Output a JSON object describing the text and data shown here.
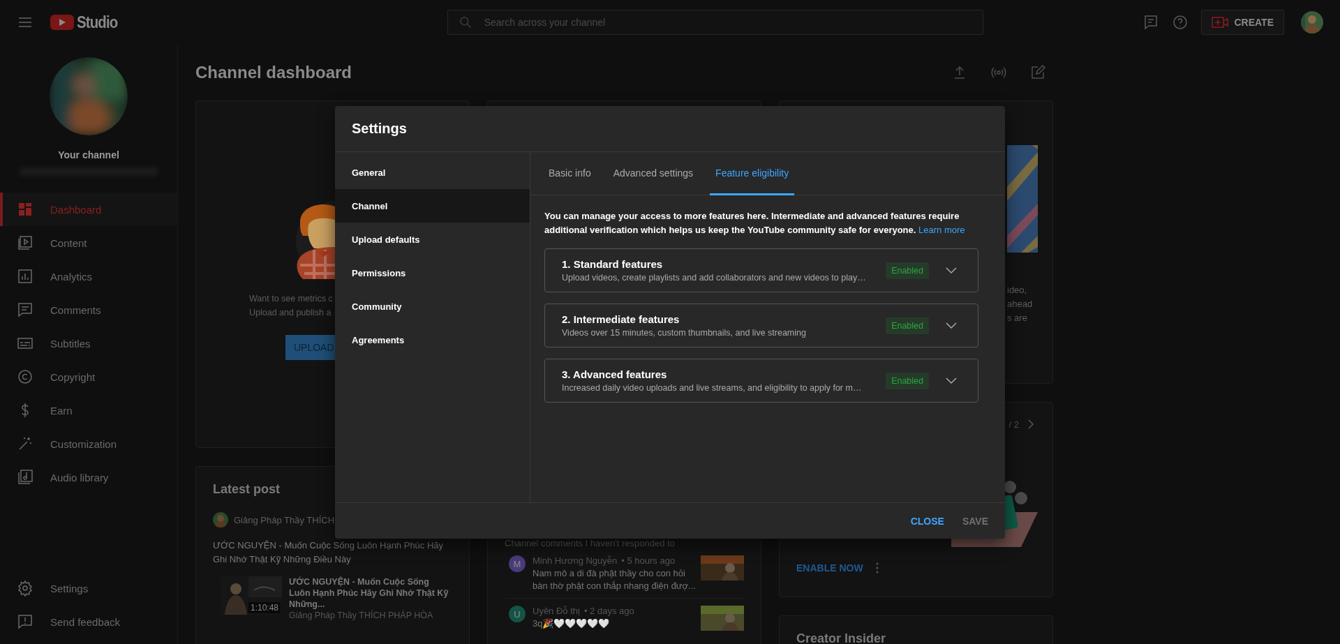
{
  "topbar": {
    "logo_text": "Studio",
    "search": {
      "placeholder": "Search across your channel"
    },
    "create_label": "CREATE"
  },
  "sidebar": {
    "channel_label": "Your channel",
    "items": [
      {
        "label": "Dashboard",
        "selected": true
      },
      {
        "label": "Content",
        "selected": false
      },
      {
        "label": "Analytics",
        "selected": false
      },
      {
        "label": "Comments",
        "selected": false
      },
      {
        "label": "Subtitles",
        "selected": false
      },
      {
        "label": "Copyright",
        "selected": false
      },
      {
        "label": "Earn",
        "selected": false
      },
      {
        "label": "Customization",
        "selected": false
      },
      {
        "label": "Audio library",
        "selected": false
      }
    ],
    "footer_items": [
      {
        "label": "Settings"
      },
      {
        "label": "Send feedback"
      }
    ]
  },
  "page": {
    "title": "Channel dashboard"
  },
  "upload_card": {
    "lines": [
      "Want to see metrics c",
      "Upload and publish a"
    ],
    "button": "UPLOAD"
  },
  "latest_post": {
    "title": "Latest post",
    "author": "Giảng Pháp Thầy THÍCH",
    "text": "ƯỚC NGUYỆN - Muốn Cuộc Sống Luôn Hạnh Phúc Hãy Ghi Nhớ Thật Kỹ Những Điều Này",
    "video": {
      "duration": "1:10:48",
      "title": "ƯỚC NGUYỆN - Muốn Cuộc Sống Luôn Hạnh Phúc Hãy Ghi Nhớ Thật Kỹ Những...",
      "channel": "Giảng Pháp Thầy THÍCH PHÁP HÒA"
    }
  },
  "comments_card": {
    "subtitle": "Channel comments I haven't responded to",
    "comments": [
      {
        "initial": "M",
        "color": "#4a3a7a",
        "author": "Minh Hương Nguyễn",
        "time": "• 5 hours ago",
        "text": "Nam mô a di đà phật  thầy cho con hỏi bàn thờ phật con thắp nhang điện đượ..."
      },
      {
        "initial": "U",
        "color": "#135447",
        "author": "Uyên Đỗ thị",
        "time": "• 2 days ago",
        "text": "3q🎉🤍🤍🤍🤍🤍"
      }
    ]
  },
  "side_cards": {
    "fragments": [
      "ideo,",
      "ahead",
      "s are"
    ],
    "pager": "/ 2",
    "enable_button": "ENABLE NOW",
    "insider_title": "Creator Insider"
  },
  "dialog": {
    "title": "Settings",
    "nav": [
      {
        "label": "General",
        "selected": false
      },
      {
        "label": "Channel",
        "selected": true
      },
      {
        "label": "Upload defaults",
        "selected": false
      },
      {
        "label": "Permissions",
        "selected": false
      },
      {
        "label": "Community",
        "selected": false
      },
      {
        "label": "Agreements",
        "selected": false
      }
    ],
    "tabs": [
      {
        "label": "Basic info",
        "selected": false
      },
      {
        "label": "Advanced settings",
        "selected": false
      },
      {
        "label": "Feature eligibility",
        "selected": true
      }
    ],
    "intro": {
      "text": "You can manage your access to more features here. Intermediate and advanced features require additional verification which helps us keep the YouTube community safe for everyone.",
      "link": "Learn more"
    },
    "features": [
      {
        "title": "1. Standard features",
        "description": "Upload videos, create playlists and add collaborators and new videos to play…",
        "status": "Enabled"
      },
      {
        "title": "2. Intermediate features",
        "description": "Videos over 15 minutes, custom thumbnails, and live streaming",
        "status": "Enabled"
      },
      {
        "title": "3. Advanced features",
        "description": "Increased daily video uploads and live streams, and eligibility to apply for m…",
        "status": "Enabled"
      }
    ],
    "buttons": [
      {
        "label": "CLOSE",
        "disabled": false
      },
      {
        "label": "SAVE",
        "disabled": true
      }
    ]
  }
}
